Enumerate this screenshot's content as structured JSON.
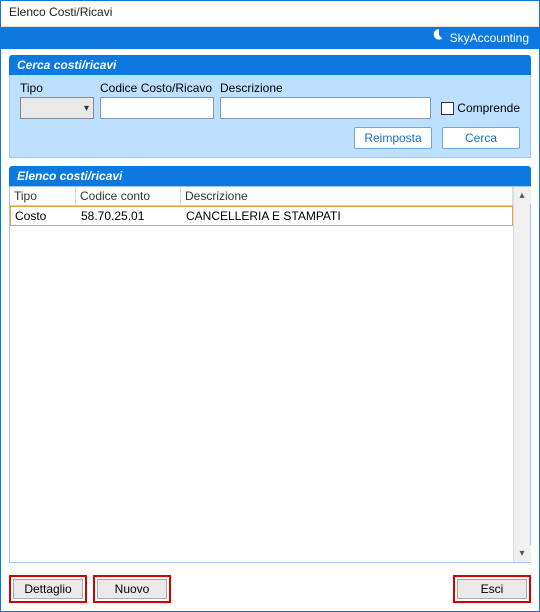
{
  "window": {
    "title": "Elenco Costi/Ricavi"
  },
  "brand": {
    "name": "SkyAccounting"
  },
  "search": {
    "heading": "Cerca costi/ricavi",
    "labels": {
      "tipo": "Tipo",
      "codice": "Codice Costo/Ricavo",
      "descrizione": "Descrizione"
    },
    "values": {
      "tipo": "",
      "codice": "",
      "descrizione": ""
    },
    "comprende_label": "Comprende",
    "buttons": {
      "reset": "Reimposta",
      "search": "Cerca"
    }
  },
  "list": {
    "heading": "Elenco costi/ricavi",
    "columns": {
      "tipo": "Tipo",
      "codice": "Codice conto",
      "descrizione": "Descrizione"
    },
    "rows": [
      {
        "tipo": "Costo",
        "codice": "58.70.25.01",
        "descrizione": "CANCELLERIA E STAMPATI"
      }
    ]
  },
  "footer": {
    "dettaglio": "Dettaglio",
    "nuovo": "Nuovo",
    "esci": "Esci"
  }
}
